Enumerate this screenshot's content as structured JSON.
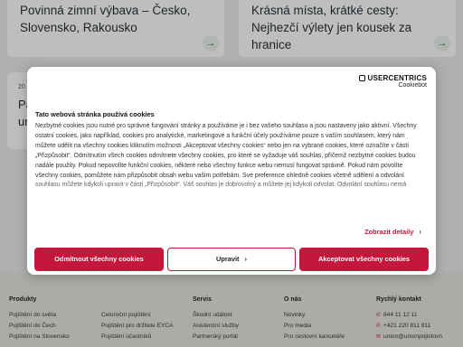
{
  "cards": [
    {
      "title": "Povinná zimní výbava – Česko, Slovensko, Rakousko",
      "arrow": "→"
    },
    {
      "title": "Krásná místa, krátké cesty: Nejhezčí výlety jen kousek za hranice",
      "arrow": "→"
    },
    {
      "year": "20",
      "title_fragment_1": "Pa",
      "title_fragment_2": "un"
    }
  ],
  "footer": {
    "columns": [
      {
        "heading": "Produkty",
        "items": [
          "Pojištění do světa",
          "Pojištění do Čech",
          "Pojištění na Slovensko"
        ]
      },
      {
        "heading": "",
        "items": [
          "Celoroční pojištění",
          "Pojištění pro držitele EYCA",
          "Pojištění účastníků"
        ]
      },
      {
        "heading": "Servis",
        "items": [
          "Škodní událost",
          "Asistenční služby",
          "Partnerský portál"
        ]
      },
      {
        "heading": "O nás",
        "items": [
          "Novinky",
          "Pro media",
          "Pro cestovní kanceláře"
        ]
      },
      {
        "heading": "Rychlý kontakt",
        "items": [
          "844 11 12 11",
          "+421 220 811 811",
          "union@unionpojistovn"
        ]
      }
    ]
  },
  "cookie_dialog": {
    "brand_top": "USERCENTRICS",
    "brand_bottom": "Cookiebot",
    "title": "Tato webová stránka používá cookies",
    "body": "Nezbytné cookies jsou nutné pro správné fungování stránky a používáme je i bez vašeho souhlasu a jsou nastaveny jako aktivní. Všechny ostatní cookies, jako například, cookies pro analytické, marketingové a funkční účely používáme pouze s vaším souhlasem, který nám můžete udělit na všechny cookies kliknutím možnosti „Akceptovat všechny cookies“ nebo jen na vybrané cookies, které označíte v části „Přizpůsobit“. Odmítnutím všech cookies odmítnete všechny cookies, pro které se vyžaduje váš souhlas, přičemž nezbytné cookies budou nadále použity. Pokud nepovolíte funkční cookies, některé nebo všechny funkce webu nemusí fungovat správně. Pokud nám povolíte všechny cookies, pomůžete nám přizpůsobit obsah webu vašim potřebám. Své preference ohledně cookies včetně udělení a odvolání souhlasu můžete kdykoli upravit v části „Přizpůsobit“. Váš souhlas je dobrovolný a můžete jej kdykoli odvolat. Odvolání souhlasu nemá",
    "details_link": "Zobrazit detaily",
    "deny_button": "Odmítnout všechny cookies",
    "customize_button": "Upravit",
    "accept_button": "Akceptovat všechny cookies"
  }
}
